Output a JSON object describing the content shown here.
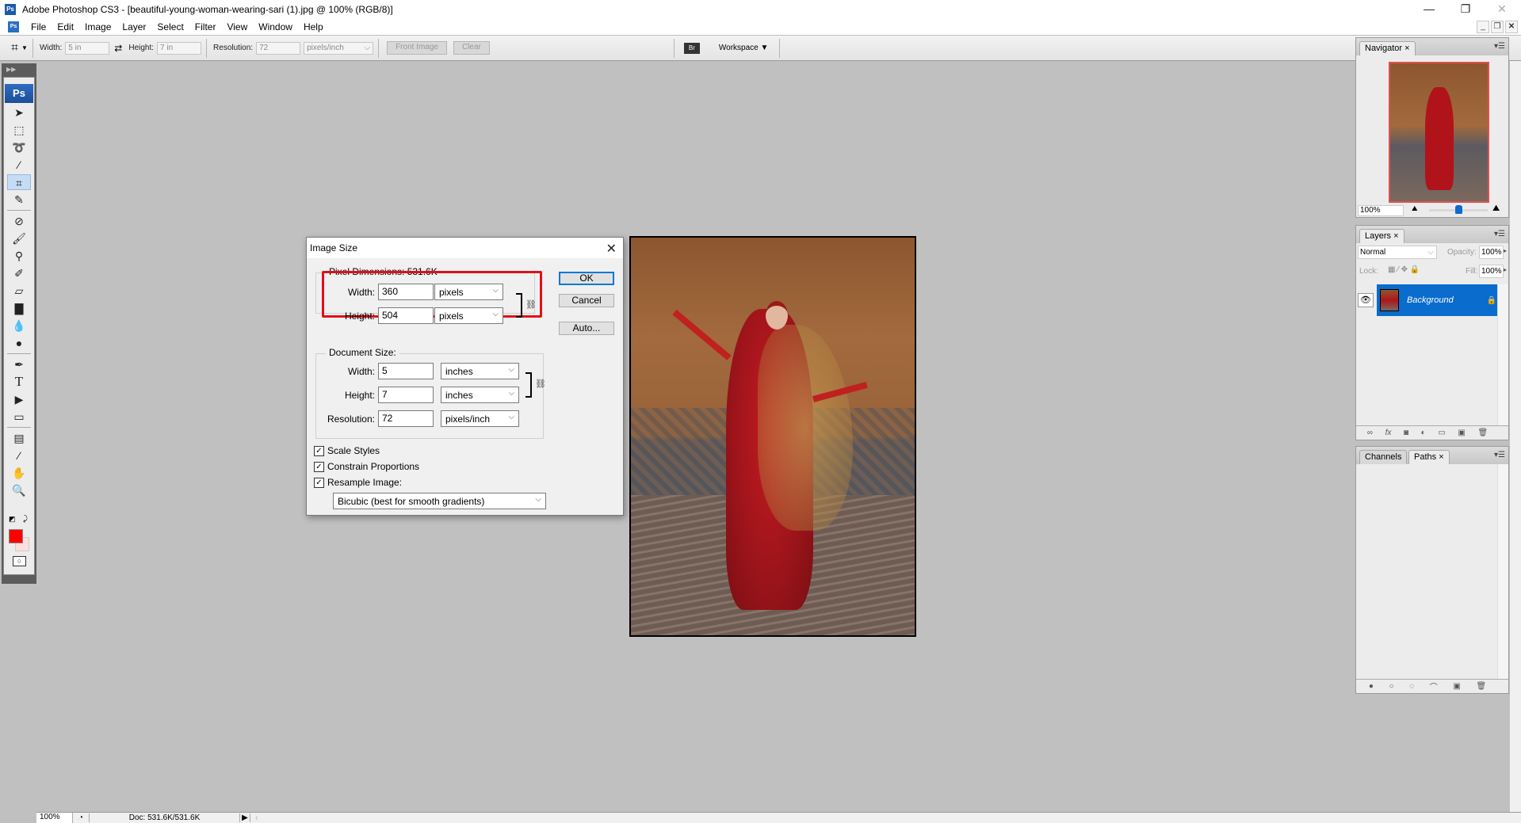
{
  "window": {
    "title": "Adobe Photoshop CS3 - [beautiful-young-woman-wearing-sari (1).jpg @ 100% (RGB/8)]",
    "app_icon": "Ps",
    "controls": {
      "minimize": "—",
      "restore": "❐",
      "close": "✕"
    },
    "doc_controls": {
      "minimize": "_",
      "restore": "❐",
      "close": "✕"
    }
  },
  "menu": {
    "icon": "Ps",
    "items": [
      "File",
      "Edit",
      "Image",
      "Layer",
      "Select",
      "Filter",
      "View",
      "Window",
      "Help"
    ]
  },
  "options_bar": {
    "tool_icon": "crop-icon",
    "width_label": "Width:",
    "width_value": "5 in",
    "swap_icon": "⇄",
    "height_label": "Height:",
    "height_value": "7 in",
    "resolution_label": "Resolution:",
    "resolution_value": "72",
    "resolution_unit": "pixels/inch",
    "front_image_label": "Front Image",
    "clear_label": "Clear",
    "bridge_icon": "Br",
    "workspace_label": "Workspace ▼"
  },
  "toolbox": {
    "logo": "Ps",
    "tools": [
      {
        "name": "move-tool",
        "glyph": "➤"
      },
      {
        "name": "marquee-tool",
        "glyph": "⬚"
      },
      {
        "name": "lasso-tool",
        "glyph": "➰"
      },
      {
        "name": "magic-wand-tool",
        "glyph": "⁄"
      },
      {
        "name": "crop-tool",
        "glyph": "⌗",
        "active": true
      },
      {
        "name": "slice-tool",
        "glyph": "✎"
      },
      {
        "name": "healing-brush-tool",
        "glyph": "⊘"
      },
      {
        "name": "brush-tool",
        "glyph": "🖌"
      },
      {
        "name": "clone-stamp-tool",
        "glyph": "⚲"
      },
      {
        "name": "history-brush-tool",
        "glyph": "✐"
      },
      {
        "name": "eraser-tool",
        "glyph": "▱"
      },
      {
        "name": "gradient-tool",
        "glyph": "▇"
      },
      {
        "name": "blur-tool",
        "glyph": "💧"
      },
      {
        "name": "dodge-tool",
        "glyph": "●"
      },
      {
        "name": "pen-tool",
        "glyph": "✒"
      },
      {
        "name": "type-tool",
        "glyph": "T"
      },
      {
        "name": "path-selection-tool",
        "glyph": "▶"
      },
      {
        "name": "rectangle-tool",
        "glyph": "▭"
      },
      {
        "name": "notes-tool",
        "glyph": "▤"
      },
      {
        "name": "eyedropper-tool",
        "glyph": "⁄"
      },
      {
        "name": "hand-tool",
        "glyph": "✋"
      },
      {
        "name": "zoom-tool",
        "glyph": "🔍"
      }
    ],
    "foreground_color": "#ff0000",
    "background_color": "#ffdede"
  },
  "dialog": {
    "title": "Image Size",
    "close": "✕",
    "pixel_dimensions": {
      "legend": "Pixel Dimensions:  531.6K",
      "width_label": "Width:",
      "width_value": "360",
      "width_unit": "pixels",
      "height_label": "Height:",
      "height_value": "504",
      "height_unit": "pixels"
    },
    "document_size": {
      "legend": "Document Size:",
      "width_label": "Width:",
      "width_value": "5",
      "width_unit": "inches",
      "height_label": "Height:",
      "height_value": "7",
      "height_unit": "inches",
      "resolution_label": "Resolution:",
      "resolution_value": "72",
      "resolution_unit": "pixels/inch"
    },
    "buttons": {
      "ok": "OK",
      "cancel": "Cancel",
      "auto": "Auto..."
    },
    "checkboxes": [
      {
        "label": "Scale Styles",
        "checked": true
      },
      {
        "label": "Constrain Proportions",
        "checked": true
      },
      {
        "label": "Resample Image:",
        "checked": true
      }
    ],
    "resample_method": "Bicubic (best for smooth gradients)",
    "highlight_color": "#e0101a"
  },
  "navigator": {
    "tab": "Navigator",
    "zoom_value": "100%",
    "zoom_slider_fraction": 0.5
  },
  "layers": {
    "tab": "Layers",
    "blend_mode": "Normal",
    "opacity_label": "Opacity:",
    "opacity_value": "100%",
    "lock_label": "Lock:",
    "fill_label": "Fill:",
    "fill_value": "100%",
    "items": [
      {
        "name": "Background",
        "visible": true,
        "locked": true,
        "selected": true
      }
    ],
    "selected_color": "#0a6ccc"
  },
  "paths_panel": {
    "tabs": [
      "Channels",
      "Paths"
    ],
    "active_tab": "Paths"
  },
  "statusbar": {
    "zoom": "100%",
    "doc_info": "Doc: 531.6K/531.6K"
  }
}
